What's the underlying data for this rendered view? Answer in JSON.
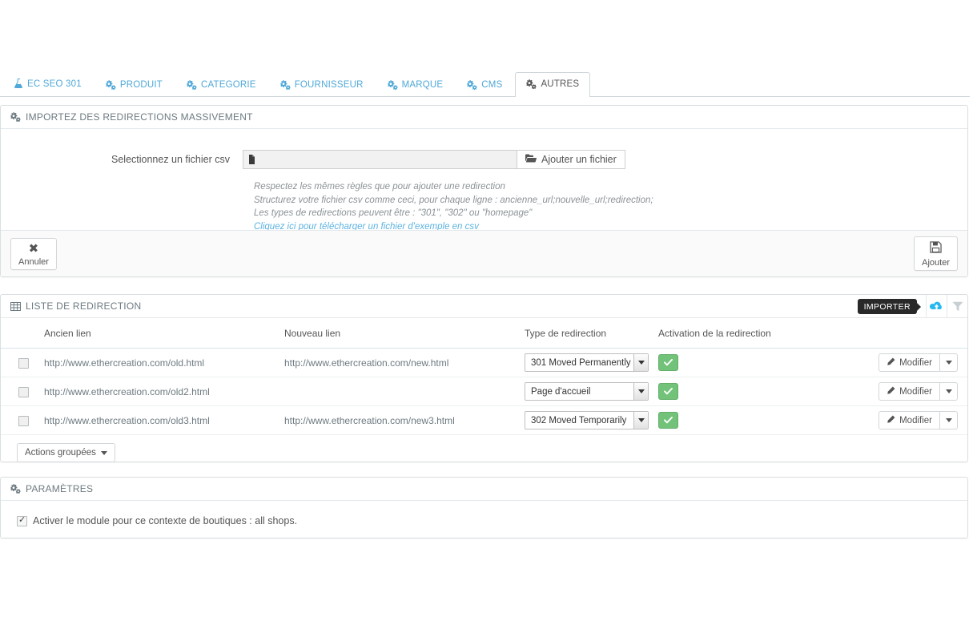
{
  "tabs": [
    {
      "label": "EC SEO 301",
      "icon": "flask-icon",
      "active": false
    },
    {
      "label": "PRODUIT",
      "icon": "gears-icon",
      "active": false
    },
    {
      "label": "CATEGORIE",
      "icon": "gears-icon",
      "active": false
    },
    {
      "label": "FOURNISSEUR",
      "icon": "gears-icon",
      "active": false
    },
    {
      "label": "MARQUE",
      "icon": "gears-icon",
      "active": false
    },
    {
      "label": "CMS",
      "icon": "gears-icon",
      "active": false
    },
    {
      "label": "AUTRES",
      "icon": "gears-icon",
      "active": true
    }
  ],
  "import_panel": {
    "title": "IMPORTEZ DES REDIRECTIONS MASSIVEMENT",
    "icon": "gears-icon",
    "file_label": "Selectionnez un fichier csv",
    "file_value": "",
    "file_button": "Ajouter un fichier",
    "help_lines": [
      "Respectez les mêmes règles que pour ajouter une redirection",
      "Structurez votre fichier csv comme ceci, pour chaque ligne : ancienne_url;nouvelle_url;redirection;",
      "Les types de redirections peuvent être : \"301\", \"302\" ou \"homepage\""
    ],
    "help_link": "Cliquez ici pour télécharger un fichier d'exemple en csv",
    "cancel_label": "Annuler",
    "submit_label": "Ajouter"
  },
  "list_panel": {
    "title": "LISTE DE REDIRECTION",
    "icon": "table-icon",
    "tooltip": "IMPORTER",
    "upload_icon": "cloud-upload-icon",
    "filter_icon": "funnel-icon",
    "columns": [
      "",
      "Ancien lien",
      "Nouveau lien",
      "Type de redirection",
      "Activation de la redirection",
      ""
    ],
    "rows": [
      {
        "checked": false,
        "old_link": "http://www.ethercreation.com/old.html",
        "new_link": "http://www.ethercreation.com/new.html",
        "type": "301 Moved Permanently",
        "active": true,
        "edit_label": "Modifier"
      },
      {
        "checked": false,
        "old_link": "http://www.ethercreation.com/old2.html",
        "new_link": "",
        "type": "Page d'accueil",
        "active": true,
        "edit_label": "Modifier"
      },
      {
        "checked": false,
        "old_link": "http://www.ethercreation.com/old3.html",
        "new_link": "http://www.ethercreation.com/new3.html",
        "type": "302 Moved Temporarily",
        "active": true,
        "edit_label": "Modifier"
      }
    ],
    "bulk_actions_label": "Actions groupées"
  },
  "params_panel": {
    "title": "PARAMÈTRES",
    "icon": "gears-icon",
    "checkbox_checked": true,
    "checkbox_label": "Activer le module pour ce contexte de boutiques : all shops."
  },
  "colors": {
    "tab_blue": "#4fa8d8",
    "link_blue": "#5cb3e0",
    "green": "#72c279",
    "tooltip_bg": "#292929"
  }
}
